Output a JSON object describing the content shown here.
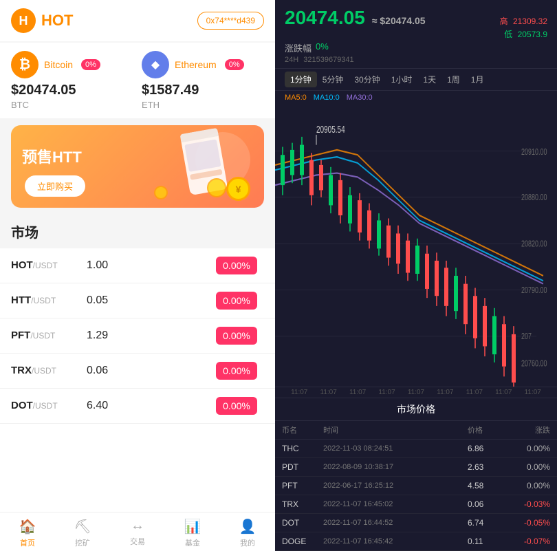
{
  "header": {
    "logo_text": "HOT",
    "wallet_address": "0x74****d439"
  },
  "crypto_cards": [
    {
      "name": "Bitcoin",
      "symbol": "BTC",
      "price": "$20474.05",
      "change": "0%",
      "icon_type": "btc"
    },
    {
      "name": "Ethereum",
      "symbol": "ETH",
      "price": "$1587.49",
      "change": "0%",
      "icon_type": "eth"
    }
  ],
  "banner": {
    "text": "预售HTT",
    "button_label": "立即购买"
  },
  "market": {
    "title": "市场",
    "items": [
      {
        "name": "HOT",
        "sub": "/USDT",
        "price": "1.00",
        "change": "0.00%",
        "change_type": "neutral"
      },
      {
        "name": "HTT",
        "sub": "/USDT",
        "price": "0.05",
        "change": "0.00%",
        "change_type": "neutral"
      },
      {
        "name": "PFT",
        "sub": "/USDT",
        "price": "1.29",
        "change": "0.00%",
        "change_type": "neutral"
      },
      {
        "name": "TRX",
        "sub": "/USDT",
        "price": "0.06",
        "change": "0.00%",
        "change_type": "neutral"
      },
      {
        "name": "DOT",
        "sub": "/USDT",
        "price": "6.40",
        "change": "0.00%",
        "change_type": "neutral"
      }
    ]
  },
  "nav": {
    "items": [
      {
        "label": "首页",
        "icon": "🏠",
        "active": true
      },
      {
        "label": "挖矿",
        "icon": "⛏",
        "active": false
      },
      {
        "label": "交易",
        "icon": "↔",
        "active": false
      },
      {
        "label": "基金",
        "icon": "📊",
        "active": false
      },
      {
        "label": "我的",
        "icon": "👤",
        "active": false
      }
    ]
  },
  "chart": {
    "price_main": "20474.05",
    "price_approx": "≈ $20474.05",
    "change_label": "涨跌幅",
    "change_val": "0%",
    "volume_label": "24H",
    "volume_val": "321539679341",
    "high_label": "高",
    "high_val": "21309.32",
    "low_label": "低",
    "low_val": "20573.9",
    "ma5_label": "MA5:0",
    "ma10_label": "MA10:0",
    "ma30_label": "MA30:0",
    "annotation": "20905.54",
    "time_tabs": [
      "1分钟",
      "5分钟",
      "30分钟",
      "1小时",
      "1天",
      "1周",
      "1月"
    ],
    "active_tab": "1分钟",
    "time_axis": [
      "11:07",
      "11:07",
      "11:07",
      "11:07",
      "11:07",
      "11:07",
      "11:07",
      "11:07",
      "11:07"
    ],
    "price_labels": [
      "20910.00",
      "20880.00",
      "20820.00",
      "20790.00",
      "207",
      "20760.00"
    ]
  },
  "market_table": {
    "title": "市场价格",
    "headers": [
      "币名",
      "时间",
      "价格",
      "涨跌"
    ],
    "rows": [
      {
        "coin": "THC",
        "time": "2022-11-03 08:24:51",
        "price": "6.86",
        "change": "0.00%",
        "change_type": "neutral"
      },
      {
        "coin": "PDT",
        "time": "2022-08-09 10:38:17",
        "price": "2.63",
        "change": "0.00%",
        "change_type": "neutral"
      },
      {
        "coin": "PFT",
        "time": "2022-06-17 16:25:12",
        "price": "4.58",
        "change": "0.00%",
        "change_type": "neutral"
      },
      {
        "coin": "TRX",
        "time": "2022-11-07 16:45:02",
        "price": "0.06",
        "change": "-0.03%",
        "change_type": "down"
      },
      {
        "coin": "DOT",
        "time": "2022-11-07 16:44:52",
        "price": "6.74",
        "change": "-0.05%",
        "change_type": "down"
      },
      {
        "coin": "DOGE",
        "time": "2022-11-07 16:45:42",
        "price": "0.11",
        "change": "-0.07%",
        "change_type": "down"
      }
    ]
  }
}
